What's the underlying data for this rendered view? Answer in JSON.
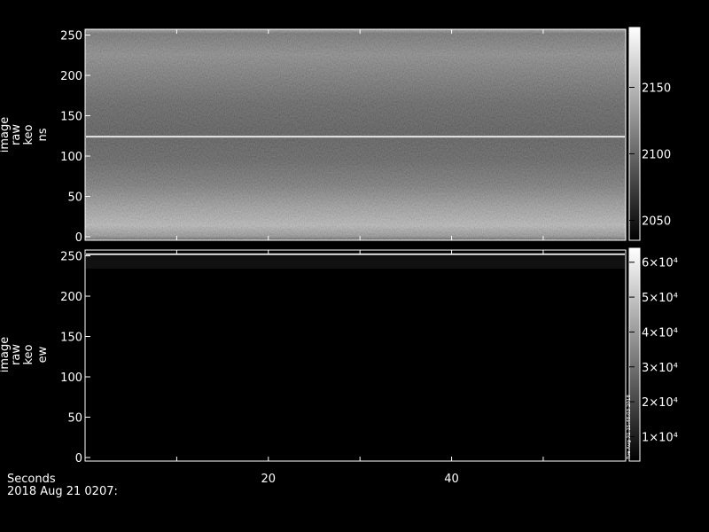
{
  "chart_data": [
    {
      "type": "heatmap",
      "panel": "top",
      "ylabel_lines": [
        "image",
        "raw",
        "keo",
        "ns"
      ],
      "y_ticks": [
        0,
        50,
        100,
        150,
        200,
        250
      ],
      "ylim": [
        0,
        255
      ],
      "xlim": [
        0,
        59
      ],
      "bright_row": 124,
      "colorbar": {
        "ticks": [
          "2050",
          "2100",
          "2150"
        ],
        "range": [
          2035,
          2195
        ]
      }
    },
    {
      "type": "heatmap",
      "panel": "bottom",
      "ylabel_lines": [
        "image",
        "raw",
        "keo",
        "ew"
      ],
      "y_ticks": [
        0,
        50,
        100,
        150,
        200,
        250
      ],
      "ylim": [
        0,
        255
      ],
      "xlim": [
        0,
        59
      ],
      "bright_row": 252,
      "colorbar": {
        "ticks": [
          "1×10⁴",
          "2×10⁴",
          "3×10⁴",
          "4×10⁴",
          "5×10⁴",
          "6×10⁴"
        ],
        "range": [
          3000,
          64000
        ],
        "side_label": "Tue Aug 21 15:48:03 2018"
      }
    }
  ],
  "x_axis": {
    "label": "Seconds",
    "ticks": [
      20,
      40
    ],
    "date": "2018 Aug 21 0207:"
  }
}
